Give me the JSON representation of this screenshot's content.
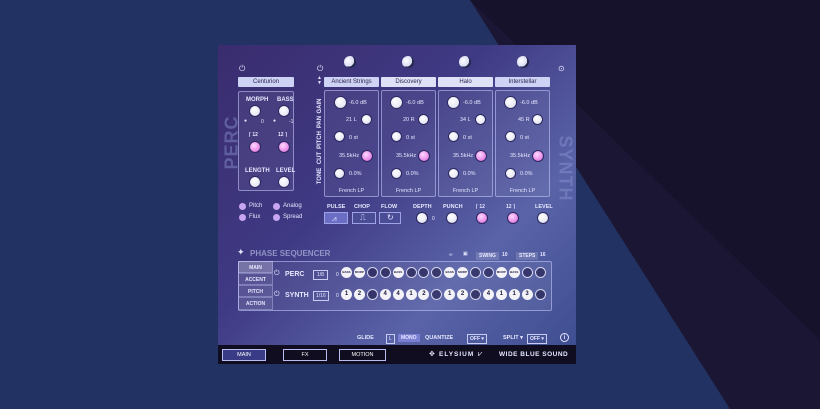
{
  "perc": {
    "title": "PERC",
    "preset": "Centurion",
    "morph_label": "MORPH",
    "bass_label": "BASS",
    "morph_value": "0",
    "bass_value": "-1",
    "filter_left": "⌈ 12",
    "filter_right": "12 ⌉",
    "length_label": "LENGTH",
    "level_label": "LEVEL",
    "pitch_label": "Pitch",
    "analog_label": "Analog",
    "flux_label": "Flux",
    "spread_label": "Spread"
  },
  "synth": {
    "title": "SYNTH",
    "row_labels": [
      "GAIN",
      "PAN",
      "PITCH",
      "CUT",
      "TONE"
    ],
    "layers": [
      {
        "preset": "Ancient Strings",
        "gain": "-6.0 dB",
        "pan": "21 L",
        "pitch": "0 st",
        "cut": "35.5kHz",
        "tone": "0.0%",
        "filter": "French LP"
      },
      {
        "preset": "Discovery",
        "gain": "-6.0 dB",
        "pan": "20 R",
        "pitch": "0 st",
        "cut": "35.5kHz",
        "tone": "0.0%",
        "filter": "French LP"
      },
      {
        "preset": "Halo",
        "gain": "-6.0 dB",
        "pan": "34 L",
        "pitch": "0 st",
        "cut": "35.5kHz",
        "tone": "0.0%",
        "filter": "French LP"
      },
      {
        "preset": "Interstellar",
        "gain": "-6.0 dB",
        "pan": "45 R",
        "pitch": "0 st",
        "cut": "35.5kHz",
        "tone": "0.0%",
        "filter": "French LP"
      }
    ]
  },
  "fx_row": {
    "pulse": "PULSE",
    "chop": "CHOP",
    "flow": "FLOW",
    "depth": "DEPTH",
    "depth_value": "0",
    "punch": "PUNCH",
    "filter_left": "⌈ 12",
    "filter_right": "12 ⌉",
    "level": "LEVEL"
  },
  "sequencer": {
    "title": "PHASE SEQUENCER",
    "swing_label": "SWING",
    "swing_value": "10",
    "steps_label": "STEPS",
    "steps_value": "16",
    "tabs": [
      "MAIN",
      "ACCENT",
      "PITCH",
      "ACTION"
    ],
    "perc": {
      "label": "PERC",
      "rate": "1/8",
      "first": "0",
      "steps": [
        "BASS",
        "MORPH",
        "",
        "",
        "BASS",
        "",
        "",
        "",
        "BASS",
        "MORPH",
        "",
        "",
        "MORPH",
        "BASS",
        "",
        ""
      ]
    },
    "synth": {
      "label": "SYNTH",
      "rate": "1/16",
      "first": "0",
      "steps": [
        "1",
        "2",
        "",
        "4",
        "4",
        "1",
        "2",
        "",
        "1",
        "2",
        "",
        "4",
        "1",
        "1",
        "3",
        ""
      ]
    }
  },
  "bottom": {
    "glide_label": "GLIDE",
    "glide_value": "L",
    "mono_label": "MONO",
    "quantize_label": "QUANTIZE",
    "quantize_value": "OFF ▾",
    "split_label": "SPLIT ▾",
    "split_value": "OFF ▾",
    "info": "i"
  },
  "footer": {
    "tab_main": "MAIN",
    "tab_fx": "FX",
    "tab_motion": "MOTION",
    "brand1": "ELYSIUM",
    "brand2": "WIDE BLUE SOUND"
  },
  "colors": {
    "accent_pink": "#ea8fe9",
    "background": "#223262",
    "panel": "#3f3a84"
  }
}
